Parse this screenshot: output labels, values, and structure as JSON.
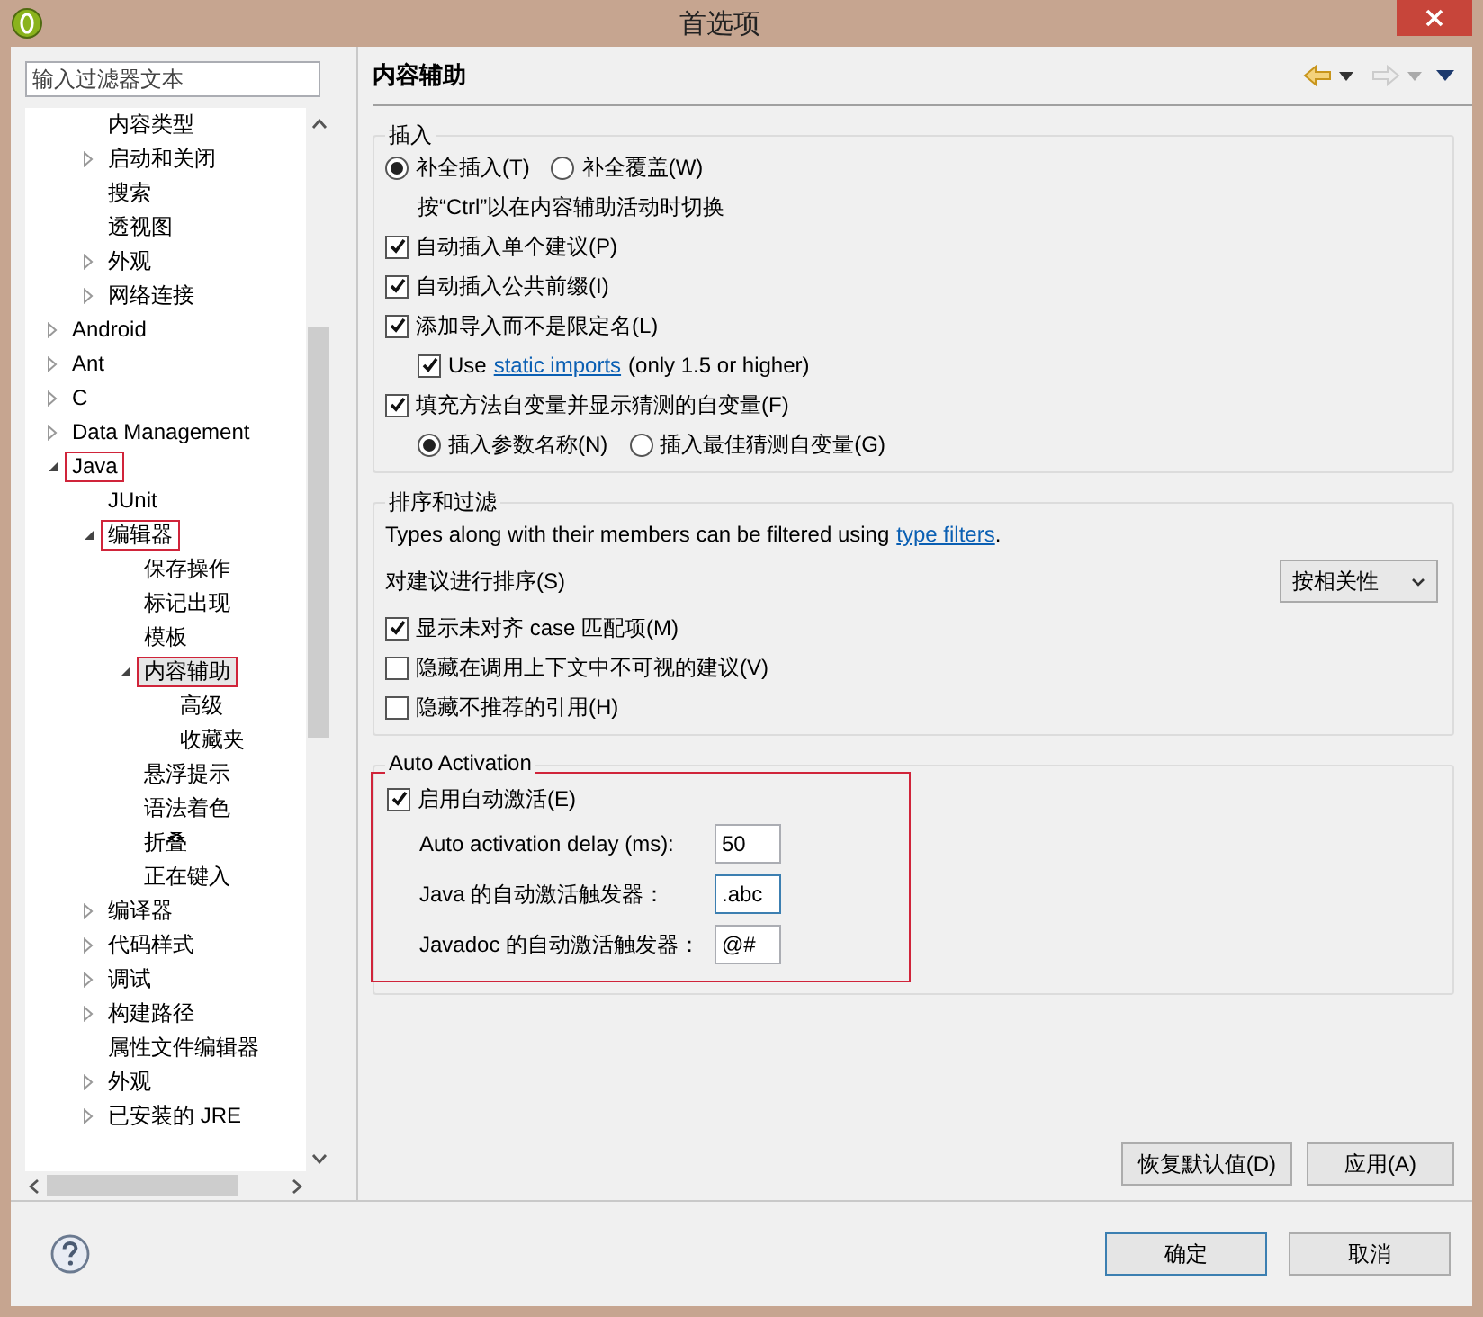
{
  "window": {
    "title": "首选项"
  },
  "filter": {
    "placeholder": "输入过滤器文本"
  },
  "tree": {
    "partial_children": [
      {
        "label": "内容类型"
      },
      {
        "label": "启动和关闭",
        "expanded": false
      },
      {
        "label": "搜索"
      },
      {
        "label": "透视图"
      },
      {
        "label": "外观",
        "expanded": false
      },
      {
        "label": "网络连接",
        "expanded": false
      }
    ],
    "items": [
      {
        "label": "Android",
        "expanded": false
      },
      {
        "label": "Ant",
        "expanded": false
      },
      {
        "label": "C",
        "expanded": false
      },
      {
        "label": "Data Management",
        "expanded": false
      },
      {
        "label": "Java",
        "expanded": true,
        "highlighted": true,
        "children": [
          {
            "label": "JUnit"
          },
          {
            "label": "编辑器",
            "expanded": true,
            "highlighted": true,
            "children": [
              {
                "label": "保存操作"
              },
              {
                "label": "标记出现"
              },
              {
                "label": "模板"
              },
              {
                "label": "内容辅助",
                "expanded": true,
                "highlighted": true,
                "selected": true,
                "children": [
                  {
                    "label": "高级"
                  },
                  {
                    "label": "收藏夹"
                  }
                ]
              },
              {
                "label": "悬浮提示"
              },
              {
                "label": "语法着色"
              },
              {
                "label": "折叠"
              },
              {
                "label": "正在键入"
              }
            ]
          },
          {
            "label": "编译器",
            "expanded": false
          },
          {
            "label": "代码样式",
            "expanded": false
          },
          {
            "label": "调试",
            "expanded": false
          },
          {
            "label": "构建路径",
            "expanded": false
          },
          {
            "label": "属性文件编辑器"
          },
          {
            "label": "外观",
            "expanded": false
          },
          {
            "label": "已安装的 JRE",
            "expanded": false
          }
        ]
      }
    ]
  },
  "page": {
    "title": "内容辅助",
    "insertion": {
      "title": "插入",
      "radios": [
        {
          "label": "补全插入(T)",
          "selected": true
        },
        {
          "label": "补全覆盖(W)",
          "selected": false
        }
      ],
      "hint": "按“Ctrl”以在内容辅助活动时切换",
      "options": [
        {
          "label": "自动插入单个建议(P)",
          "checked": true
        },
        {
          "label": "自动插入公共前缀(I)",
          "checked": true
        },
        {
          "label": "添加导入而不是限定名(L)",
          "checked": true,
          "children": [
            {
              "label": "Use",
              "link": "static imports",
              "suffix": "(only 1.5 or higher)",
              "checked": true
            }
          ]
        },
        {
          "label": "填充方法自变量并显示猜测的自变量(F)",
          "checked": true,
          "radios": [
            {
              "label": "插入参数名称(N)",
              "selected": true
            },
            {
              "label": "插入最佳猜测自变量(G)",
              "selected": false
            }
          ]
        }
      ]
    },
    "sorting": {
      "title": "排序和过滤",
      "text": "Types along with their members can be filtered using",
      "link": "type filters",
      "text_end": ".",
      "sort_label": "对建议进行排序(S)",
      "sort_value": "按相关性",
      "options": [
        {
          "label": "显示未对齐 case 匹配项(M)",
          "checked": true
        },
        {
          "label": "隐藏在调用上下文中不可视的建议(V)",
          "checked": false
        },
        {
          "label": "隐藏不推荐的引用(H)",
          "checked": false
        }
      ]
    },
    "auto": {
      "title": "Auto Activation",
      "highlighted": true,
      "enable": {
        "label": "启用自动激活(E)",
        "checked": true
      },
      "fields": [
        {
          "label": "Auto activation delay (ms):",
          "value": "50",
          "focused": false
        },
        {
          "label": "Java 的自动激活触发器：",
          "value": ".abc",
          "focused": true
        },
        {
          "label": "Javadoc 的自动激活触发器：",
          "value": "@#",
          "focused": false
        }
      ]
    },
    "buttons": [
      "恢复默认值(D)",
      "应用(A)"
    ]
  },
  "footer": {
    "buttons": [
      {
        "label": "确定",
        "default": true
      },
      {
        "label": "取消",
        "default": false
      }
    ]
  }
}
